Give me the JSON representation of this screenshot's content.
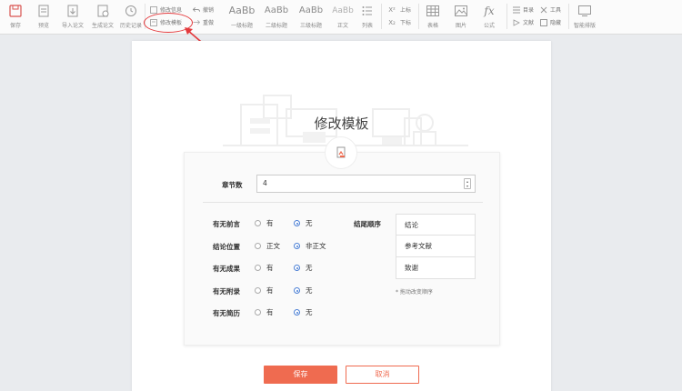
{
  "toolbar": {
    "save": "保存",
    "preview": "预览",
    "import_paper": "导入论文",
    "generate_paper": "生成论文",
    "history": "历史记录",
    "modify_info": "修改信息",
    "modify_template": "修改模板",
    "undo": "撤销",
    "redo": "重做",
    "aabb": "AaBb",
    "heading1": "一级标题",
    "heading2": "二级标题",
    "heading3": "三级标题",
    "body_text": "正文",
    "list": "列表",
    "superscript": "上标",
    "subscript": "下标",
    "table": "表格",
    "image": "图片",
    "formula": "公式",
    "toc": "目录",
    "tools": "工具",
    "references": "文献",
    "hide": "隐藏",
    "smart_layout": "智能排版",
    "accent_color": "#e4393c"
  },
  "template_dialog": {
    "title": "修改模板",
    "chapter_count_label": "章节数",
    "chapter_count_value": "4",
    "rows": [
      {
        "label": "有无前言",
        "opt1": "有",
        "opt2": "无",
        "selected": 2
      },
      {
        "label": "结论位置",
        "opt1": "正文",
        "opt2": "非正文",
        "selected": 2
      },
      {
        "label": "有无成果",
        "opt1": "有",
        "opt2": "无",
        "selected": 2
      },
      {
        "label": "有无附录",
        "opt1": "有",
        "opt2": "无",
        "selected": 2
      },
      {
        "label": "有无简历",
        "opt1": "有",
        "opt2": "无",
        "selected": 2
      }
    ],
    "ending_order_label": "结尾顺序",
    "ending_order_items": [
      "结论",
      "参考文献",
      "致谢"
    ],
    "drag_hint": "* 拖动改变顺序",
    "save_label": "保存",
    "cancel_label": "取消",
    "primary_color": "#ef6b50"
  }
}
